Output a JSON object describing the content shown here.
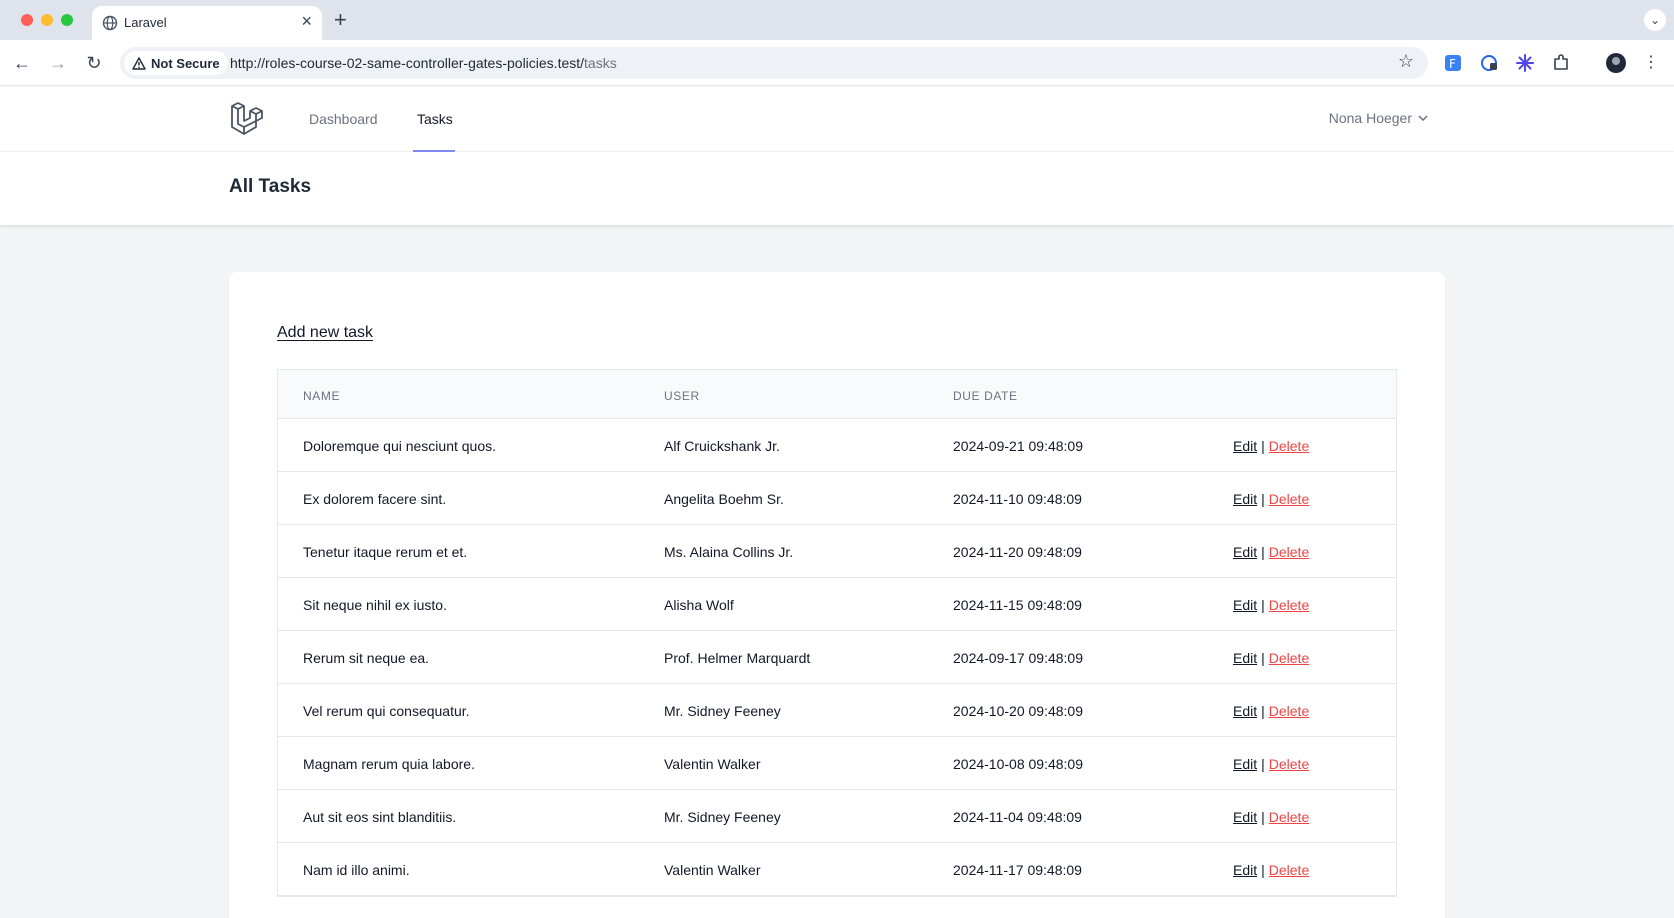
{
  "browser": {
    "tab_title": "Laravel",
    "new_tab": "+",
    "security_label": "Not Secure",
    "url_base": "http://roles-course-02-same-controller-gates-policies.test/",
    "url_path": "tasks"
  },
  "nav": {
    "links": [
      "Dashboard",
      "Tasks"
    ],
    "active": "Tasks",
    "user_name": "Nona Hoeger"
  },
  "page": {
    "title": "All Tasks",
    "add_link": "Add new task"
  },
  "table": {
    "headers": [
      "NAME",
      "USER",
      "DUE DATE"
    ],
    "edit_label": "Edit",
    "separator": "|",
    "delete_label": "Delete",
    "rows": [
      {
        "name": "Doloremque qui nesciunt quos.",
        "user": "Alf Cruickshank Jr.",
        "due": "2024-09-21 09:48:09"
      },
      {
        "name": "Ex dolorem facere sint.",
        "user": "Angelita Boehm Sr.",
        "due": "2024-11-10 09:48:09"
      },
      {
        "name": "Tenetur itaque rerum et et.",
        "user": "Ms. Alaina Collins Jr.",
        "due": "2024-11-20 09:48:09"
      },
      {
        "name": "Sit neque nihil ex iusto.",
        "user": "Alisha Wolf",
        "due": "2024-11-15 09:48:09"
      },
      {
        "name": "Rerum sit neque ea.",
        "user": "Prof. Helmer Marquardt",
        "due": "2024-09-17 09:48:09"
      },
      {
        "name": "Vel rerum qui consequatur.",
        "user": "Mr. Sidney Feeney",
        "due": "2024-10-20 09:48:09"
      },
      {
        "name": "Magnam rerum quia labore.",
        "user": "Valentin Walker",
        "due": "2024-10-08 09:48:09"
      },
      {
        "name": "Aut sit eos sint blanditiis.",
        "user": "Mr. Sidney Feeney",
        "due": "2024-11-04 09:48:09"
      },
      {
        "name": "Nam id illo animi.",
        "user": "Valentin Walker",
        "due": "2024-11-17 09:48:09"
      }
    ]
  },
  "colors": {
    "accent": "#818cf8",
    "delete": "#ef4444",
    "background": "#f3f4f6"
  }
}
